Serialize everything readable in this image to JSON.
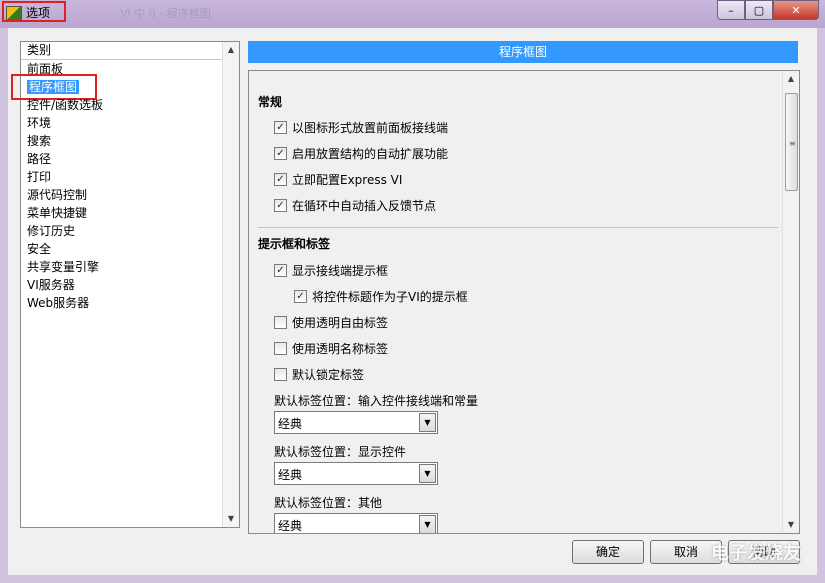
{
  "window": {
    "title": "选项",
    "faded_title": "VI 中 0 - 程序框图",
    "close_label": "✕",
    "min_label": "–",
    "max_label": "▢"
  },
  "category_list": {
    "header": "类别",
    "items": [
      "前面板",
      "程序框图",
      "控件/函数选板",
      "环境",
      "搜索",
      "路径",
      "打印",
      "源代码控制",
      "菜单快捷键",
      "修订历史",
      "安全",
      "共享变量引擎",
      "VI服务器",
      "Web服务器"
    ],
    "selected": "程序框图"
  },
  "panel": {
    "title": "程序框图",
    "general": {
      "heading": "常规",
      "options": [
        {
          "label": "以图标形式放置前面板接线端",
          "checked": true
        },
        {
          "label": "启用放置结构的自动扩展功能",
          "checked": true
        },
        {
          "label": "立即配置Express VI",
          "checked": true
        },
        {
          "label": "在循环中自动插入反馈节点",
          "checked": true
        }
      ]
    },
    "tips": {
      "heading": "提示框和标签",
      "options": [
        {
          "label": "显示接线端提示框",
          "checked": true
        },
        {
          "label": "将控件标题作为子VI的提示框",
          "checked": true
        },
        {
          "label": "使用透明自由标签",
          "checked": false
        },
        {
          "label": "使用透明名称标签",
          "checked": false
        },
        {
          "label": "默认锁定标签",
          "checked": false
        }
      ],
      "selects": [
        {
          "label": "默认标签位置：输入控件接线端和常量",
          "value": "经典"
        },
        {
          "label": "默认标签位置：显示控件",
          "value": "经典"
        },
        {
          "label": "默认标签位置：其他",
          "value": "经典"
        }
      ]
    }
  },
  "buttons": {
    "ok": "确定",
    "cancel": "取消",
    "help": "帮助"
  },
  "watermark": "电子发烧友"
}
